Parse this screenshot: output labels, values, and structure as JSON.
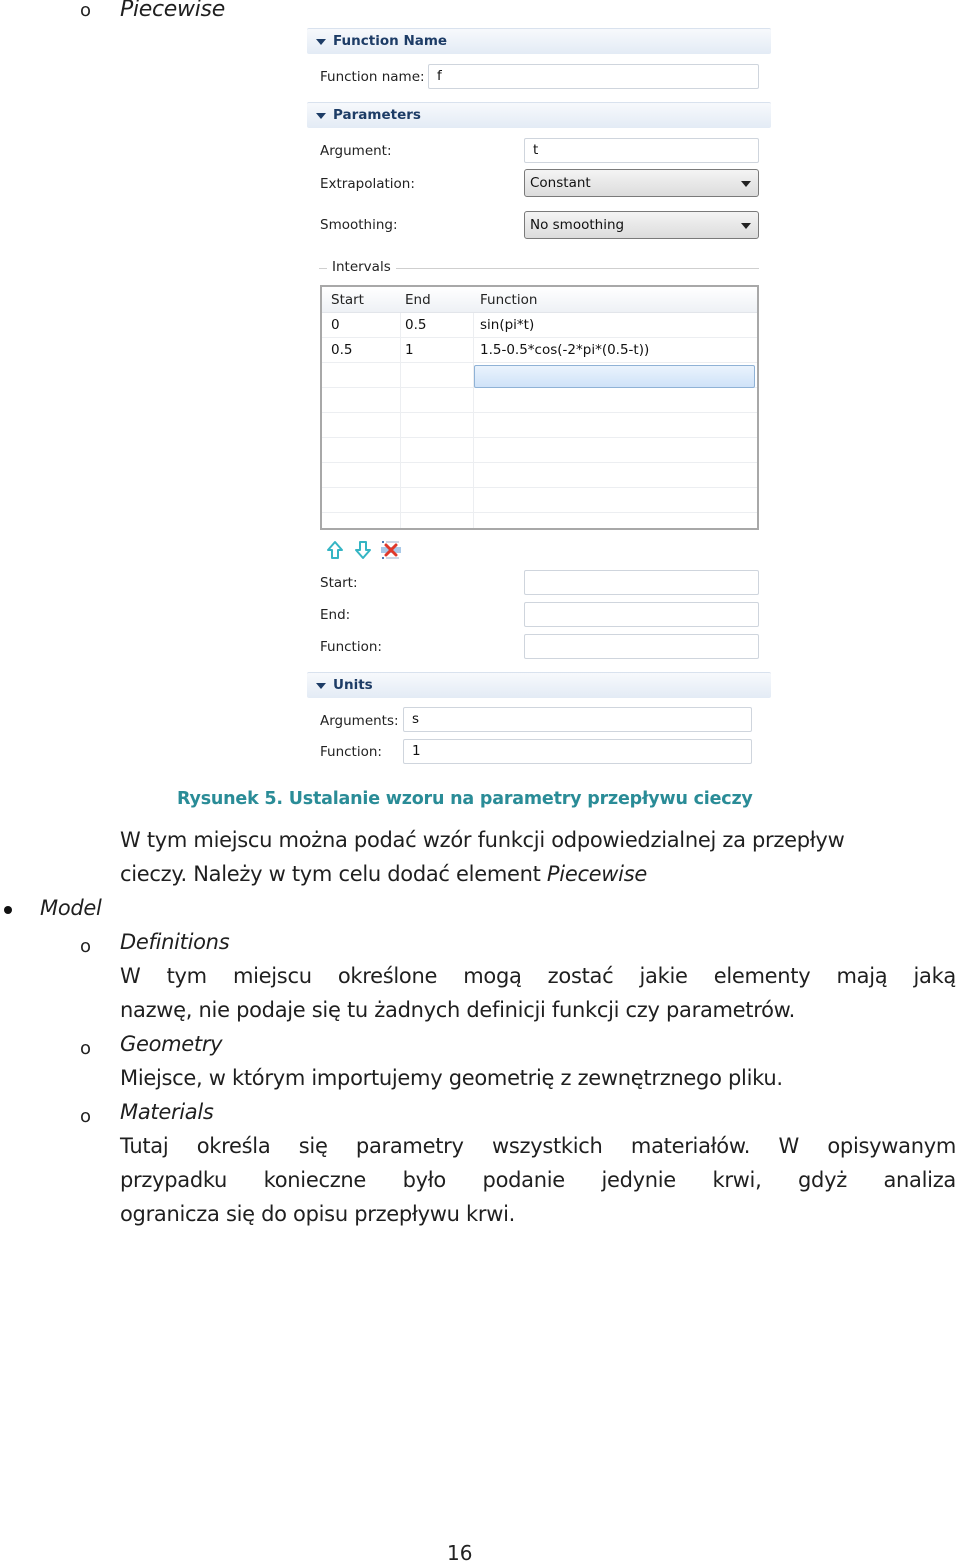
{
  "top_item": {
    "bullet": "o",
    "label": "Piecewise"
  },
  "panel": {
    "sections": {
      "function_name": "Function Name",
      "parameters": "Parameters",
      "units": "Units"
    },
    "function_name": {
      "label": "Function name:",
      "value": "f"
    },
    "parameters": {
      "argument": {
        "label": "Argument:",
        "value": "t"
      },
      "extrapolation": {
        "label": "Extrapolation:",
        "value": "Constant"
      },
      "smoothing": {
        "label": "Smoothing:",
        "value": "No smoothing"
      }
    },
    "intervals": {
      "title": "Intervals",
      "columns": [
        "Start",
        "End",
        "Function"
      ],
      "rows": [
        [
          "0",
          "0.5",
          "sin(pi*t)"
        ],
        [
          "0.5",
          "1",
          "1.5-0.5*cos(-2*pi*(0.5-t))"
        ]
      ],
      "toolbar_icons": [
        "move-up-icon",
        "move-down-icon",
        "delete-row-icon"
      ]
    },
    "editor": {
      "start": {
        "label": "Start:",
        "value": ""
      },
      "end": {
        "label": "End:",
        "value": ""
      },
      "function": {
        "label": "Function:",
        "value": ""
      }
    },
    "units": {
      "arguments": {
        "label": "Arguments:",
        "value": "s"
      },
      "function": {
        "label": "Function:",
        "value": "1"
      }
    },
    "colors": {
      "section_title": "#1d3c66",
      "selection": "#cfe2f8",
      "icon_accent": "#35b5c4",
      "delete_red": "#e0392b"
    }
  },
  "caption": "Rysunek 5. Ustalanie wzoru na parametry przepływu cieczy",
  "caption_color": "#2a8c97",
  "body": {
    "piecewise_desc": {
      "line1": "W tym miejscu można podać wzór funkcji odpowiedzialnej za przepływ",
      "line2_prefix": "cieczy. Należy w tym celu dodać element ",
      "line2_italic": "Piecewise"
    },
    "model": {
      "bullet": "•",
      "label": "Model"
    },
    "definitions": {
      "bullet": "o",
      "label": "Definitions",
      "line1": "W tym miejscu określone mogą zostać jakie elementy mają jaką",
      "line2": "nazwę, nie podaje się tu żadnych definicji funkcji czy parametrów."
    },
    "geometry": {
      "bullet": "o",
      "label": "Geometry",
      "line1": "Miejsce, w którym importujemy geometrię z zewnętrznego pliku."
    },
    "materials": {
      "bullet": "o",
      "label": "Materials",
      "line1": "Tutaj określa się parametry wszystkich materiałów. W opisywanym",
      "line2": "przypadku konieczne było podanie jedynie krwi, gdyż analiza",
      "line3": "ogranicza się do opisu przepływu krwi."
    }
  },
  "page_number": "16"
}
